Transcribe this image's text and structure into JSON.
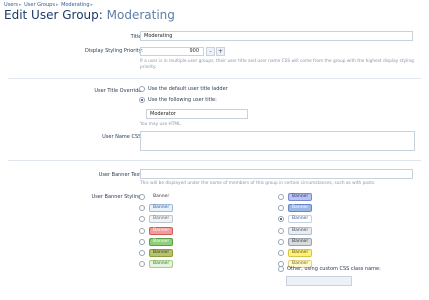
{
  "breadcrumbs": [
    "Users",
    "User Groups",
    "Moderating"
  ],
  "page": {
    "title_prefix": "Edit User Group:",
    "title_group": "Moderating"
  },
  "form": {
    "title_label": "Title:",
    "title_value": "Moderating",
    "priority_label": "Display Styling Priority:",
    "priority_value": "900",
    "priority_minus": "-",
    "priority_plus": "+",
    "priority_hint": "If a user is in multiple user groups, their user title and user name CSS will come from the group with the highest display styling priority.",
    "user_title_override_label": "User Title Override:",
    "option_default_title": "Use the default user title ladder",
    "option_following_title": "Use the following user title:",
    "user_title_value": "Moderator",
    "html_hint": "You may use HTML.",
    "user_name_css_label": "User Name CSS:",
    "banner_text_label": "User Banner Text:",
    "banner_hint": "This will be displayed under the name of members of this group in certain circumstances, such as with posts.",
    "banner_styling_label": "User Banner Styling:",
    "custom_css_option": "Other, using custom CSS class name:"
  },
  "banners": [
    {
      "label": "Banner",
      "style": "none",
      "bg": "#ffffff",
      "border": "#ffffff",
      "color": "#333333",
      "selected": false
    },
    {
      "label": "Banner",
      "style": "lightblue",
      "bg": "#e9f1fb",
      "border": "#9fb9d8",
      "color": "#2f5a92",
      "selected": false
    },
    {
      "label": "Banner",
      "style": "lightgray",
      "bg": "#f1f3f5",
      "border": "#bcc4cc",
      "color": "#5c6b7a",
      "selected": false
    },
    {
      "label": "Banner",
      "style": "red",
      "bg": "#f39a9a",
      "border": "#d05b5b",
      "color": "#ffffff",
      "selected": false
    },
    {
      "label": "Banner",
      "style": "green",
      "bg": "#8fcf7a",
      "border": "#5c9f4a",
      "color": "#ffffff",
      "selected": false
    },
    {
      "label": "Banner",
      "style": "olive",
      "bg": "#b7c46a",
      "border": "#8c9c3f",
      "color": "#333333",
      "selected": false
    },
    {
      "label": "Banner",
      "style": "lightgreen",
      "bg": "#e4f5db",
      "border": "#a4cf8e",
      "color": "#3a6e2c",
      "selected": false
    },
    {
      "label": "Banner",
      "style": "lavender",
      "bg": "#b9c2f1",
      "border": "#7c88cf",
      "color": "#2d3570",
      "selected": false
    },
    {
      "label": "Banner",
      "style": "blue",
      "bg": "#9bb7e6",
      "border": "#6688c6",
      "color": "#ffffff",
      "selected": false
    },
    {
      "label": "Banner",
      "style": "white",
      "bg": "#ffffff",
      "border": "#c8d2de",
      "color": "#2f5a92",
      "selected": true
    },
    {
      "label": "Banner",
      "style": "silver",
      "bg": "#e9edf2",
      "border": "#b4bcc6",
      "color": "#3f4a57",
      "selected": false
    },
    {
      "label": "Banner",
      "style": "darkgray",
      "bg": "#d7dbe0",
      "border": "#9aa3ad",
      "color": "#333333",
      "selected": false
    },
    {
      "label": "Banner",
      "style": "yellow",
      "bg": "#fff27a",
      "border": "#d7c642",
      "color": "#5a4a00",
      "selected": false
    },
    {
      "label": "Banner",
      "style": "lightyellow",
      "bg": "#fff8cf",
      "border": "#e2d48a",
      "color": "#6b5d12",
      "selected": false
    }
  ]
}
